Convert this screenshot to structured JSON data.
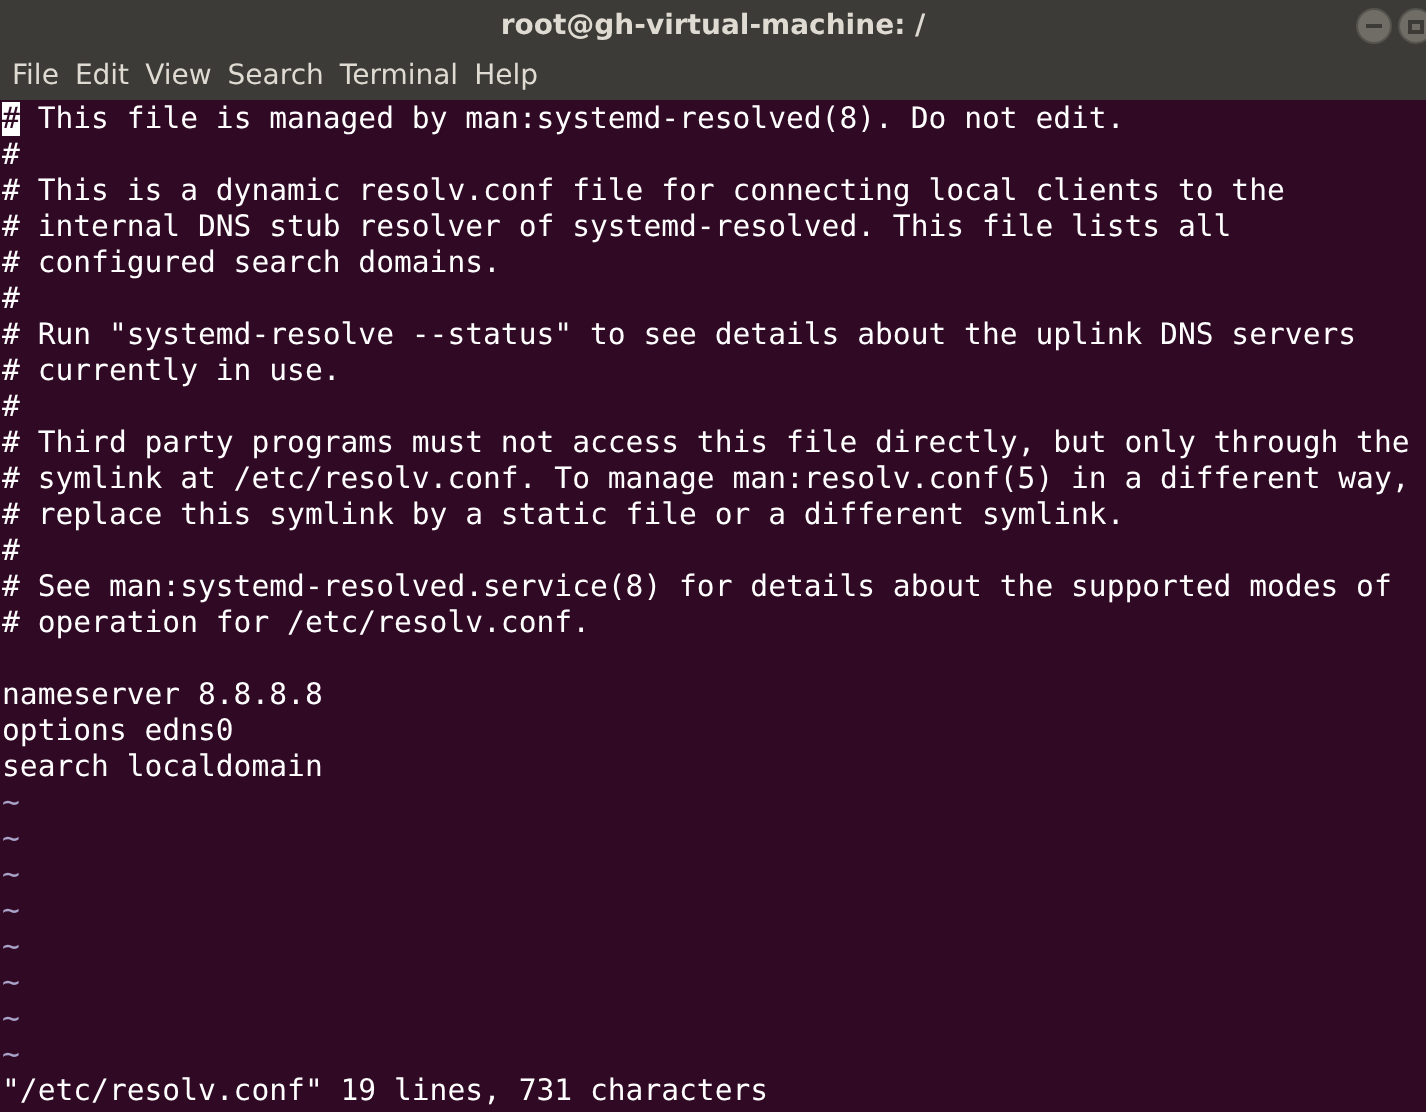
{
  "window": {
    "title": "root@gh-virtual-machine: /"
  },
  "menu": [
    {
      "label": "File"
    },
    {
      "label": "Edit"
    },
    {
      "label": "View"
    },
    {
      "label": "Search"
    },
    {
      "label": "Terminal"
    },
    {
      "label": "Help"
    }
  ],
  "editor": {
    "lines": [
      {
        "text": "# This file is managed by man:systemd-resolved(8). Do not edit.",
        "cursor": true
      },
      {
        "text": "#",
        "cursor": false
      },
      {
        "text": "# This is a dynamic resolv.conf file for connecting local clients to the",
        "cursor": false
      },
      {
        "text": "# internal DNS stub resolver of systemd-resolved. This file lists all",
        "cursor": false
      },
      {
        "text": "# configured search domains.",
        "cursor": false
      },
      {
        "text": "#",
        "cursor": false
      },
      {
        "text": "# Run \"systemd-resolve --status\" to see details about the uplink DNS servers",
        "cursor": false
      },
      {
        "text": "# currently in use.",
        "cursor": false
      },
      {
        "text": "#",
        "cursor": false
      },
      {
        "text": "# Third party programs must not access this file directly, but only through the",
        "cursor": false
      },
      {
        "text": "# symlink at /etc/resolv.conf. To manage man:resolv.conf(5) in a different way,",
        "cursor": false
      },
      {
        "text": "# replace this symlink by a static file or a different symlink.",
        "cursor": false
      },
      {
        "text": "#",
        "cursor": false
      },
      {
        "text": "# See man:systemd-resolved.service(8) for details about the supported modes of",
        "cursor": false
      },
      {
        "text": "# operation for /etc/resolv.conf.",
        "cursor": false
      },
      {
        "kind": "blank"
      },
      {
        "text": "nameserver 8.8.8.8",
        "cursor": false
      },
      {
        "text": "options edns0",
        "cursor": false
      },
      {
        "text": "search localdomain",
        "cursor": false
      }
    ],
    "empty_lines": [
      "~",
      "~",
      "~",
      "~",
      "~",
      "~",
      "~",
      "~"
    ],
    "status_line": "\"/etc/resolv.conf\" 19 lines, 731 characters"
  }
}
